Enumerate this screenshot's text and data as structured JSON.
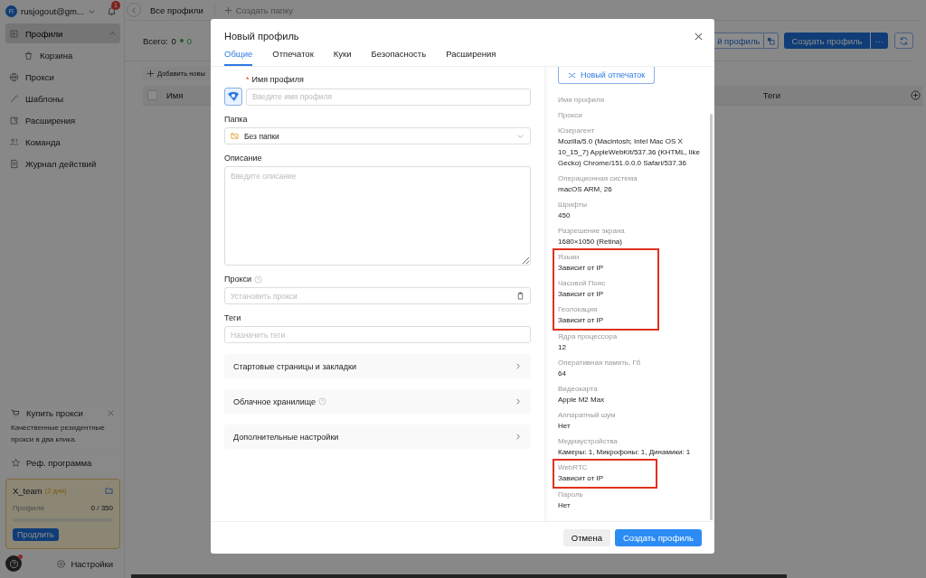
{
  "account": {
    "avatar": "R",
    "email": "rusjogout@gm...",
    "notifications": "1"
  },
  "sidebar": {
    "items": [
      {
        "label": "Профили",
        "selected": true,
        "expanded": true,
        "children": [
          {
            "label": "Корзина",
            "selected": false
          }
        ]
      },
      {
        "label": "Прокси",
        "selected": false
      },
      {
        "label": "Шаблоны",
        "selected": false
      },
      {
        "label": "Расширения",
        "selected": false
      },
      {
        "label": "Команда",
        "selected": false
      },
      {
        "label": "Журнал действий",
        "selected": false
      }
    ]
  },
  "promo": {
    "title": "Купить прокси",
    "text": "Качественные резидентные прокси в два клика."
  },
  "referral": "Реф. программа",
  "team": {
    "name": "X_team",
    "days": "(2 дня)",
    "profiles_label": "Профили",
    "profiles_count": "0 / 350",
    "level": 0,
    "renew_button": "Продлить"
  },
  "help": {
    "notification_dot": true
  },
  "settings": "Настройки",
  "toolbar": {
    "title": "Все профили",
    "new_folder": "Создать папку"
  },
  "summary": {
    "total_label": "Всего:",
    "total": "0",
    "active": "0"
  },
  "actions": {
    "partial_button": "й профиль",
    "create_button": "Создать профиль",
    "more": "···"
  },
  "add_new": "Добавить новы",
  "table": {
    "select_all_checked": false,
    "columns": [
      "Имя",
      "Теги"
    ]
  },
  "modal": {
    "title": "Новый профиль",
    "tabs": [
      {
        "label": "Общие",
        "selected": true
      },
      {
        "label": "Отпечаток",
        "selected": false
      },
      {
        "label": "Куки",
        "selected": false
      },
      {
        "label": "Безопасность",
        "selected": false
      },
      {
        "label": "Расширения",
        "selected": false
      }
    ],
    "name": {
      "label": "Имя профиля",
      "required_mark": "*",
      "placeholder": "Введите имя профиля"
    },
    "folder": {
      "label": "Папка",
      "value": "Без папки"
    },
    "description": {
      "label": "Описание",
      "placeholder": "Введите описание"
    },
    "proxy": {
      "label": "Прокси",
      "help": true,
      "placeholder": "Установить прокси"
    },
    "tags": {
      "label": "Теги",
      "placeholder": "Назначить теги"
    },
    "sections": [
      {
        "label": "Стартовые страницы и закладки",
        "help": false
      },
      {
        "label": "Облачное хранилище",
        "help": true
      },
      {
        "label": "Дополнительные настройки",
        "help": false
      }
    ],
    "fingerprint": {
      "button": "Новый отпечаток",
      "groups": [
        {
          "highlighted": false,
          "items": [
            {
              "label": "Имя профиля"
            },
            {
              "label": "Прокси"
            },
            {
              "label": "Юзерагент",
              "value": "Mozilla/5.0 (Macintosh; Intel Mac OS X 10_15_7) AppleWebKit/537.36 (KHTML, like Gecko) Chrome/151.0.0.0 Safari/537.36"
            },
            {
              "label": "Операционная система",
              "value": "macOS ARM, 26"
            },
            {
              "label": "Шрифты",
              "value": "450"
            },
            {
              "label": "Разрешение экрана",
              "value": "1680×1050 (Retina)"
            }
          ]
        },
        {
          "highlighted": true,
          "items": [
            {
              "label": "Языки",
              "value": "Зависит от IP"
            },
            {
              "label": "Часовой Пояс",
              "value": "Зависит от IP"
            },
            {
              "label": "Геолокация",
              "value": "Зависит от IP"
            }
          ]
        },
        {
          "highlighted": false,
          "items": [
            {
              "label": "Ядра процессора",
              "value": "12"
            },
            {
              "label": "Оперативная память, Гб",
              "value": "64"
            },
            {
              "label": "Видеокарта",
              "value": "Apple M2 Max"
            },
            {
              "label": "Аппаратный шум",
              "value": "Нет"
            },
            {
              "label": "Медиаустройства",
              "value": "Камеры: 1, Микрофоны: 1, Динамики: 1"
            }
          ]
        },
        {
          "highlighted": true,
          "items": [
            {
              "label": "WebRTC",
              "value": "Зависит от IP"
            }
          ]
        },
        {
          "highlighted": false,
          "items": [
            {
              "label": "Пароль",
              "value": "Нет"
            }
          ]
        }
      ]
    },
    "cancel": "Отмена",
    "submit": "Создать профиль"
  }
}
